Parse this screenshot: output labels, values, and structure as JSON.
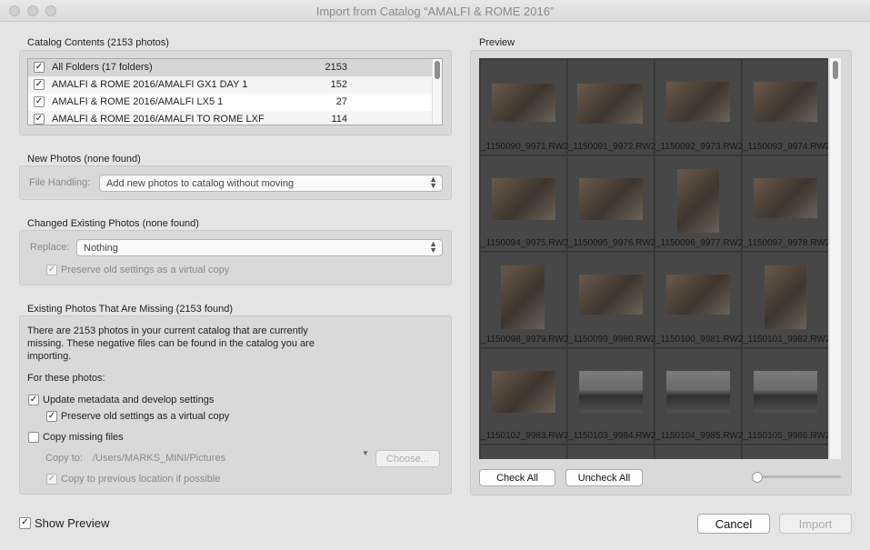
{
  "window": {
    "title": "Import from Catalog “AMALFI & ROME 2016”"
  },
  "catalog": {
    "label": "Catalog Contents (2153 photos)",
    "folders": [
      {
        "name": "All Folders (17 folders)",
        "count": "2153",
        "checked": true
      },
      {
        "name": "AMALFI & ROME 2016/AMALFI GX1 DAY 1",
        "count": "152",
        "checked": true
      },
      {
        "name": "AMALFI & ROME 2016/AMALFI LX5 1",
        "count": "27",
        "checked": true
      },
      {
        "name": "AMALFI & ROME 2016/AMALFI TO ROME LXF",
        "count": "114",
        "checked": true
      }
    ]
  },
  "new_photos": {
    "label": "New Photos (none found)",
    "file_handling_label": "File Handling:",
    "file_handling_value": "Add new photos to catalog without moving"
  },
  "changed": {
    "label": "Changed Existing Photos (none found)",
    "replace_label": "Replace:",
    "replace_value": "Nothing",
    "preserve_label": "Preserve old settings as a virtual copy"
  },
  "missing": {
    "label": "Existing Photos That Are Missing (2153 found)",
    "description_line1": "There are 2153 photos in your current catalog that are currently",
    "description_line2": "missing. These negative files can be found in the catalog you are",
    "description_line3": "importing.",
    "for_these": "For these photos:",
    "update_label": "Update metadata and develop settings",
    "preserve_label": "Preserve old settings as a virtual copy",
    "copy_missing_label": "Copy missing files",
    "copy_to_label": "Copy to:",
    "copy_to_path": "/Users/MARKS_MINI/Pictures",
    "choose_label": "Choose...",
    "copy_prev_label": "Copy to previous location if possible"
  },
  "preview": {
    "label": "Preview",
    "thumbnails": [
      "_1150090_9971.RW2",
      "_1150091_9972.RW2",
      "_1150092_9973.RW2",
      "_1150093_9974.RW2",
      "_1150094_9975.RW2",
      "_1150095_9976.RW2",
      "_1150096_9977.RW2",
      "_1150097_9978.RW2",
      "_1150098_9979.RW2",
      "_1150099_9980.RW2",
      "_1150100_9981.RW2",
      "_1150101_9982.RW2",
      "_1150102_9983.RW2",
      "_1150103_9984.RW2",
      "_1150104_9985.RW2",
      "_1150105_9986.RW2"
    ],
    "check_all": "Check All",
    "uncheck_all": "Uncheck All"
  },
  "footer": {
    "show_preview": "Show Preview",
    "cancel": "Cancel",
    "import": "Import"
  },
  "check_glyph": "✓",
  "colors": {
    "panel": "#d9d9d9",
    "preview_bg": "#3c3c3c",
    "cell_bg": "#474747"
  }
}
